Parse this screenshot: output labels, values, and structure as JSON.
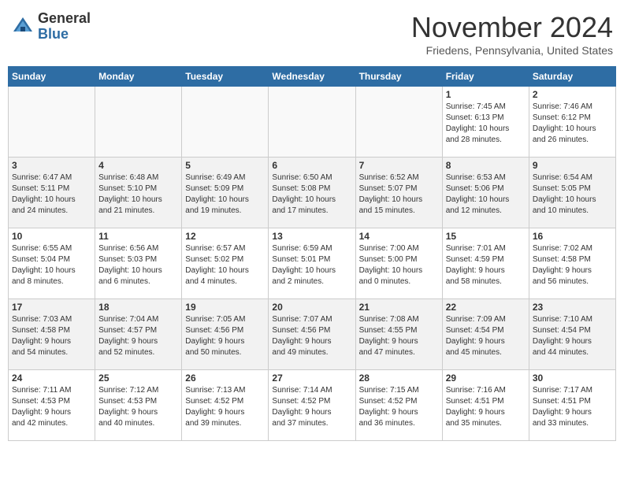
{
  "header": {
    "logo": {
      "line1": "General",
      "line2": "Blue"
    },
    "month": "November 2024",
    "location": "Friedens, Pennsylvania, United States"
  },
  "weekdays": [
    "Sunday",
    "Monday",
    "Tuesday",
    "Wednesday",
    "Thursday",
    "Friday",
    "Saturday"
  ],
  "weeks": [
    [
      {
        "day": "",
        "info": ""
      },
      {
        "day": "",
        "info": ""
      },
      {
        "day": "",
        "info": ""
      },
      {
        "day": "",
        "info": ""
      },
      {
        "day": "",
        "info": ""
      },
      {
        "day": "1",
        "info": "Sunrise: 7:45 AM\nSunset: 6:13 PM\nDaylight: 10 hours\nand 28 minutes."
      },
      {
        "day": "2",
        "info": "Sunrise: 7:46 AM\nSunset: 6:12 PM\nDaylight: 10 hours\nand 26 minutes."
      }
    ],
    [
      {
        "day": "3",
        "info": "Sunrise: 6:47 AM\nSunset: 5:11 PM\nDaylight: 10 hours\nand 24 minutes."
      },
      {
        "day": "4",
        "info": "Sunrise: 6:48 AM\nSunset: 5:10 PM\nDaylight: 10 hours\nand 21 minutes."
      },
      {
        "day": "5",
        "info": "Sunrise: 6:49 AM\nSunset: 5:09 PM\nDaylight: 10 hours\nand 19 minutes."
      },
      {
        "day": "6",
        "info": "Sunrise: 6:50 AM\nSunset: 5:08 PM\nDaylight: 10 hours\nand 17 minutes."
      },
      {
        "day": "7",
        "info": "Sunrise: 6:52 AM\nSunset: 5:07 PM\nDaylight: 10 hours\nand 15 minutes."
      },
      {
        "day": "8",
        "info": "Sunrise: 6:53 AM\nSunset: 5:06 PM\nDaylight: 10 hours\nand 12 minutes."
      },
      {
        "day": "9",
        "info": "Sunrise: 6:54 AM\nSunset: 5:05 PM\nDaylight: 10 hours\nand 10 minutes."
      }
    ],
    [
      {
        "day": "10",
        "info": "Sunrise: 6:55 AM\nSunset: 5:04 PM\nDaylight: 10 hours\nand 8 minutes."
      },
      {
        "day": "11",
        "info": "Sunrise: 6:56 AM\nSunset: 5:03 PM\nDaylight: 10 hours\nand 6 minutes."
      },
      {
        "day": "12",
        "info": "Sunrise: 6:57 AM\nSunset: 5:02 PM\nDaylight: 10 hours\nand 4 minutes."
      },
      {
        "day": "13",
        "info": "Sunrise: 6:59 AM\nSunset: 5:01 PM\nDaylight: 10 hours\nand 2 minutes."
      },
      {
        "day": "14",
        "info": "Sunrise: 7:00 AM\nSunset: 5:00 PM\nDaylight: 10 hours\nand 0 minutes."
      },
      {
        "day": "15",
        "info": "Sunrise: 7:01 AM\nSunset: 4:59 PM\nDaylight: 9 hours\nand 58 minutes."
      },
      {
        "day": "16",
        "info": "Sunrise: 7:02 AM\nSunset: 4:58 PM\nDaylight: 9 hours\nand 56 minutes."
      }
    ],
    [
      {
        "day": "17",
        "info": "Sunrise: 7:03 AM\nSunset: 4:58 PM\nDaylight: 9 hours\nand 54 minutes."
      },
      {
        "day": "18",
        "info": "Sunrise: 7:04 AM\nSunset: 4:57 PM\nDaylight: 9 hours\nand 52 minutes."
      },
      {
        "day": "19",
        "info": "Sunrise: 7:05 AM\nSunset: 4:56 PM\nDaylight: 9 hours\nand 50 minutes."
      },
      {
        "day": "20",
        "info": "Sunrise: 7:07 AM\nSunset: 4:56 PM\nDaylight: 9 hours\nand 49 minutes."
      },
      {
        "day": "21",
        "info": "Sunrise: 7:08 AM\nSunset: 4:55 PM\nDaylight: 9 hours\nand 47 minutes."
      },
      {
        "day": "22",
        "info": "Sunrise: 7:09 AM\nSunset: 4:54 PM\nDaylight: 9 hours\nand 45 minutes."
      },
      {
        "day": "23",
        "info": "Sunrise: 7:10 AM\nSunset: 4:54 PM\nDaylight: 9 hours\nand 44 minutes."
      }
    ],
    [
      {
        "day": "24",
        "info": "Sunrise: 7:11 AM\nSunset: 4:53 PM\nDaylight: 9 hours\nand 42 minutes."
      },
      {
        "day": "25",
        "info": "Sunrise: 7:12 AM\nSunset: 4:53 PM\nDaylight: 9 hours\nand 40 minutes."
      },
      {
        "day": "26",
        "info": "Sunrise: 7:13 AM\nSunset: 4:52 PM\nDaylight: 9 hours\nand 39 minutes."
      },
      {
        "day": "27",
        "info": "Sunrise: 7:14 AM\nSunset: 4:52 PM\nDaylight: 9 hours\nand 37 minutes."
      },
      {
        "day": "28",
        "info": "Sunrise: 7:15 AM\nSunset: 4:52 PM\nDaylight: 9 hours\nand 36 minutes."
      },
      {
        "day": "29",
        "info": "Sunrise: 7:16 AM\nSunset: 4:51 PM\nDaylight: 9 hours\nand 35 minutes."
      },
      {
        "day": "30",
        "info": "Sunrise: 7:17 AM\nSunset: 4:51 PM\nDaylight: 9 hours\nand 33 minutes."
      }
    ]
  ]
}
